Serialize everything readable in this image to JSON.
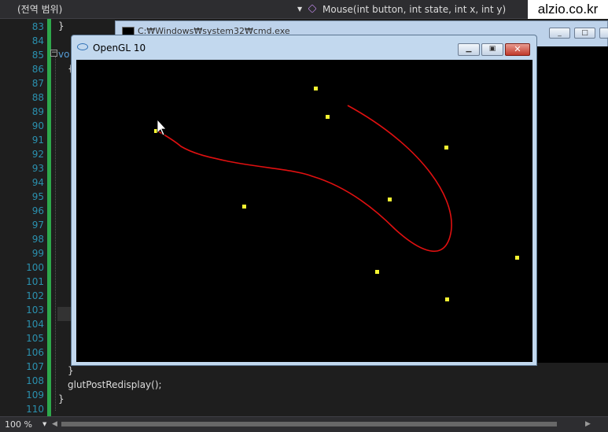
{
  "editor": {
    "scope_dropdown": "(전역 범위)",
    "function_dropdown": "Mouse(int button, int state, int x, int y)",
    "watermark": "alzio.co.kr",
    "line_numbers": [
      "83",
      "84",
      "85",
      "86",
      "87",
      "88",
      "89",
      "90",
      "91",
      "92",
      "93",
      "94",
      "95",
      "96",
      "97",
      "98",
      "99",
      "100",
      "101",
      "102",
      "103",
      "104",
      "105",
      "106",
      "107",
      "108",
      "109",
      "110"
    ],
    "code": {
      "line83": "}",
      "line85": "vo",
      "line86": "{",
      "line107": "}",
      "line108": "glutPostRedisplay();",
      "line109": "}"
    },
    "zoom": "100 %"
  },
  "cmd_window": {
    "title": "C:₩Windows₩system32₩cmd.exe"
  },
  "opengl_window": {
    "title": "OpenGL 10",
    "curve_color": "#e01010",
    "point_color": "#f5f532"
  }
}
